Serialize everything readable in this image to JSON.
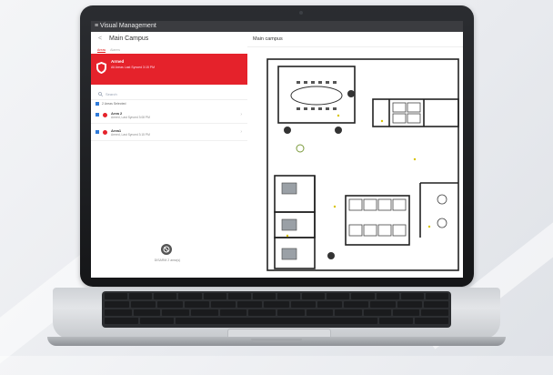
{
  "app": {
    "title": "Visual Management"
  },
  "left_panel": {
    "back_label": "<",
    "header_title": "Main Campus",
    "tabs": [
      "Areas",
      "Alarms"
    ],
    "banner": {
      "status": "Armed",
      "subtitle": "All Areas Last Synced 3:15 PM"
    },
    "search_placeholder": "Search",
    "selection_label": "2 Areas Selected",
    "areas": [
      {
        "name": "Area 2",
        "status": "Armed, Last Synced 3:08 PM"
      },
      {
        "name": "Area1",
        "status": "Armed, Last Synced 3:15 PM"
      }
    ],
    "bottom_button_label": "DISARM 2 area(s)"
  },
  "right_panel": {
    "title": "Main campus"
  },
  "colors": {
    "alarm_red": "#e5222b",
    "select_blue": "#2f7ad8"
  }
}
